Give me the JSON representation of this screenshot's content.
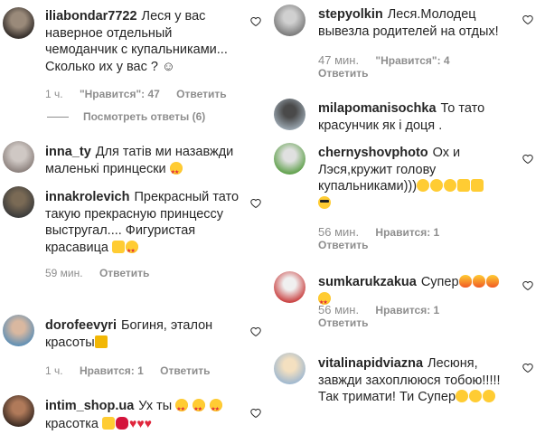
{
  "left_column": [
    {
      "username": "iliabondar7722",
      "text": "Леся у вас наверное отдельный чемоданчик с купальниками... Сколько их у вас ? ☺",
      "emojis": [],
      "time": "1 ч.",
      "likes": "\"Нравится\": 47",
      "reply": "Ответить",
      "view_replies": "Посмотреть ответы (6)"
    },
    {
      "username": "inna_ty",
      "text": "Для татів ми назавжди маленькі принцески",
      "emojis": [
        "star-struck"
      ]
    },
    {
      "username": "innakrolevich",
      "text": "Прекрасный тато такую прекрасную принцессу выстругал.... Фигуристая красавица",
      "emojis": [
        "thumbs-up",
        "star-struck"
      ],
      "time": "59 мин.",
      "reply": "Ответить"
    },
    {
      "username": "dorofeevyri",
      "text": "Богиня, эталон красоты",
      "emojis": [
        "crown"
      ],
      "time": "1 ч.",
      "likes": "Нравится: 1",
      "reply": "Ответить"
    },
    {
      "username": "intim_shop.ua",
      "text": "Ух ты",
      "text2": "красотка",
      "emojis": [
        "star-struck",
        "star-struck",
        "star-struck"
      ],
      "emojis2": [
        "ok-hand",
        "lips",
        "heart",
        "heart",
        "heart"
      ]
    }
  ],
  "right_column": [
    {
      "username": "stepyolkin",
      "text": "Леся.Молодец вывезла родителей на отдых!",
      "time": "47 мин.",
      "likes": "\"Нравится\": 4",
      "reply": "Ответить"
    },
    {
      "username": "milapomanisochka",
      "text": "То тато красунчик як і доця ."
    },
    {
      "username": "chernyshovphoto",
      "text": "Ох и Лэся,кружит голову купальниками)))",
      "emojis": [
        "yum",
        "grin",
        "wink",
        "thumbs-up",
        "ok-hand",
        "cool"
      ],
      "time": "56 мин.",
      "likes": "Нравится: 1",
      "reply": "Ответить"
    },
    {
      "username": "sumkarukzakua",
      "text": "Супер",
      "emojis": [
        "fire",
        "fire",
        "fire",
        "star-struck"
      ],
      "time": "56 мин.",
      "likes": "Нравится: 1",
      "reply": "Ответить"
    },
    {
      "username": "vitalinapidviazna",
      "text": "Лесюня, завжди захоплююся тобою!!!!! Так тримати! Ти Супер",
      "emojis": [
        "yum",
        "yum",
        "yum"
      ]
    }
  ]
}
